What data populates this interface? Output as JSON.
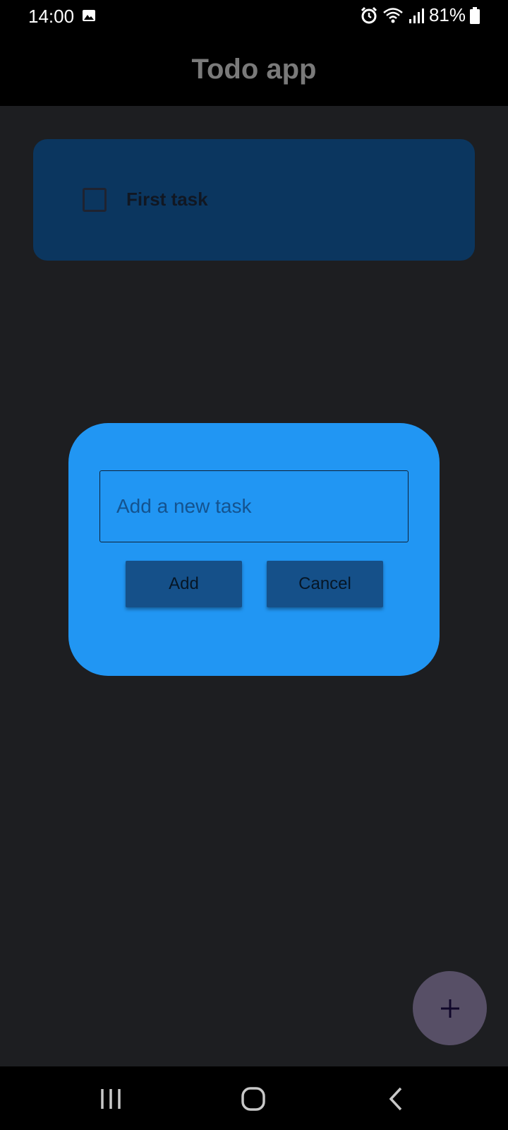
{
  "status_bar": {
    "time": "14:00",
    "battery_percent": "81%",
    "icons": [
      "image-icon",
      "alarm-icon",
      "wifi-icon",
      "signal-icon",
      "battery-icon"
    ]
  },
  "app_bar": {
    "title": "Todo app"
  },
  "tasks": [
    {
      "label": "First task",
      "checked": false
    }
  ],
  "dialog": {
    "input_placeholder": "Add a new task",
    "input_value": "",
    "add_label": "Add",
    "cancel_label": "Cancel"
  },
  "fab": {
    "icon": "plus-icon"
  },
  "nav_bar": {
    "icons": [
      "recents-icon",
      "home-icon",
      "back-icon"
    ]
  },
  "colors": {
    "background": "#1d1e21",
    "task_card": "#0b365f",
    "dialog": "#2196f3",
    "dialog_button": "#155089",
    "fab": "#574f66"
  }
}
